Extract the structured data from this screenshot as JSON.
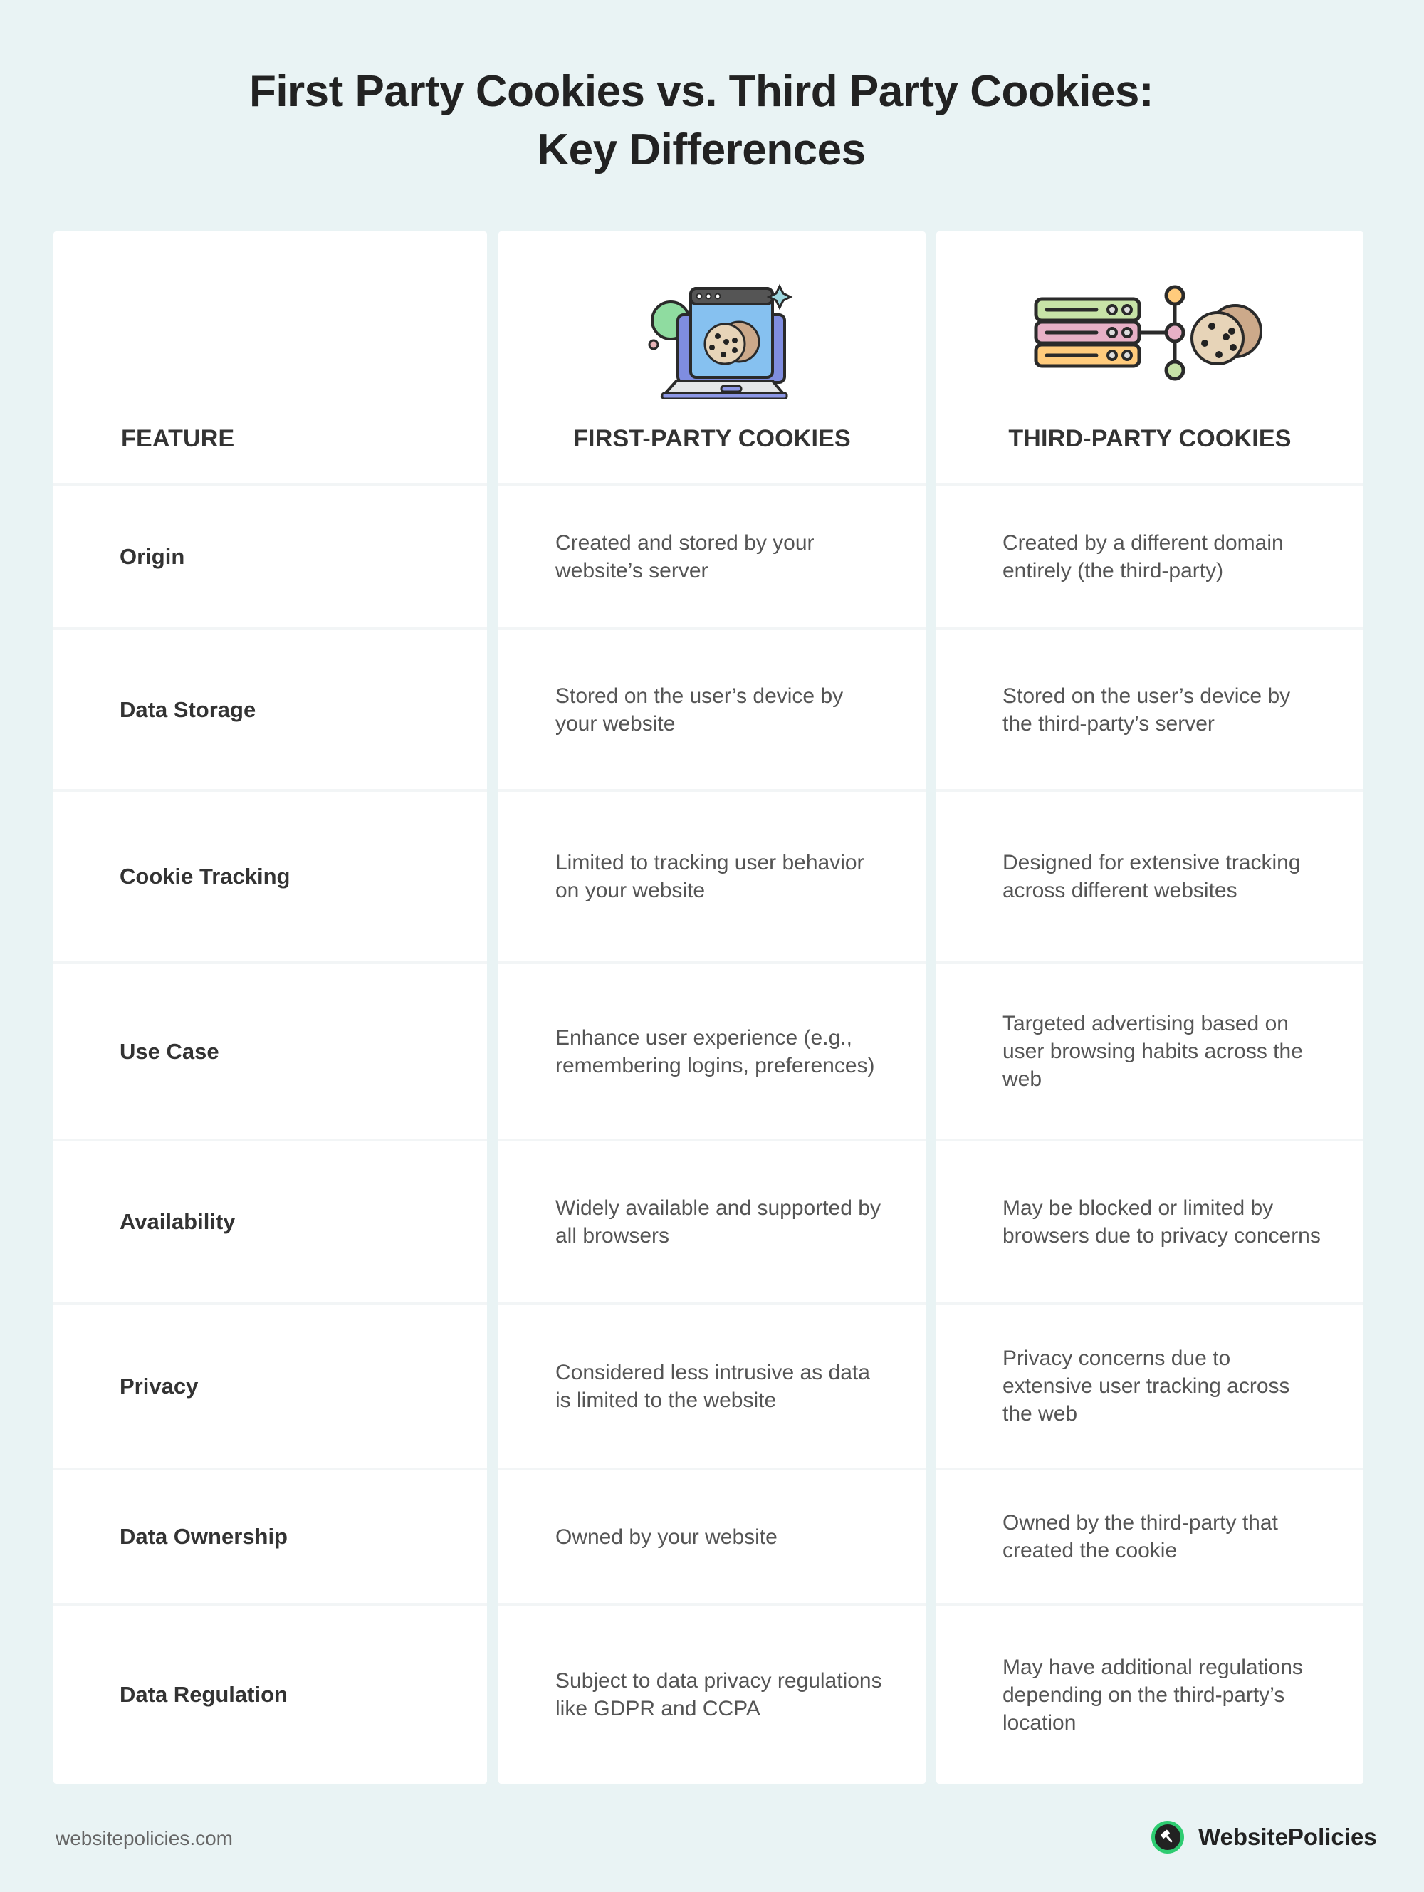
{
  "title": {
    "line1": "First Party Cookies vs. Third Party Cookies:",
    "line2": "Key Differences"
  },
  "columns": {
    "feature": "FEATURE",
    "first_party": "FIRST-PARTY COOKIES",
    "third_party": "THIRD-PARTY COOKIES"
  },
  "icons": {
    "first_party": "laptop-cookie-icon",
    "third_party": "server-cookie-icon"
  },
  "rows": [
    {
      "feature": "Origin",
      "first": "Created and stored by your website’s server",
      "third": "Created by a different domain entirely (the third-party)"
    },
    {
      "feature": "Data Storage",
      "first": "Stored on the user’s device by your website",
      "third": "Stored on the user’s device by the third-party’s server"
    },
    {
      "feature": "Cookie Tracking",
      "first": "Limited to tracking user behavior on your website",
      "third": "Designed for extensive tracking across different websites"
    },
    {
      "feature": "Use Case",
      "first": "Enhance user experience (e.g., remembering logins, preferences)",
      "third": "Targeted advertising based on user browsing habits across the web"
    },
    {
      "feature": "Availability",
      "first": "Widely available and supported by all browsers",
      "third": "May be blocked or limited by browsers due to privacy concerns"
    },
    {
      "feature": "Privacy",
      "first": "Considered less intrusive as data is limited to the website",
      "third": "Privacy concerns due to extensive user tracking across the web"
    },
    {
      "feature": "Data Ownership",
      "first": "Owned by your website",
      "third": "Owned by the third-party that created the cookie"
    },
    {
      "feature": "Data Regulation",
      "first": "Subject to data privacy regulations like GDPR and CCPA",
      "third": "May have additional regulations depending on the third-party’s location"
    }
  ],
  "footer": {
    "url": "websitepolicies.com",
    "brand": "WebsitePolicies",
    "brand_icon": "gavel-icon"
  },
  "colors": {
    "background": "#e9f3f4",
    "card": "#ffffff",
    "brand_green": "#2ecc71",
    "text_dark": "#222222"
  }
}
